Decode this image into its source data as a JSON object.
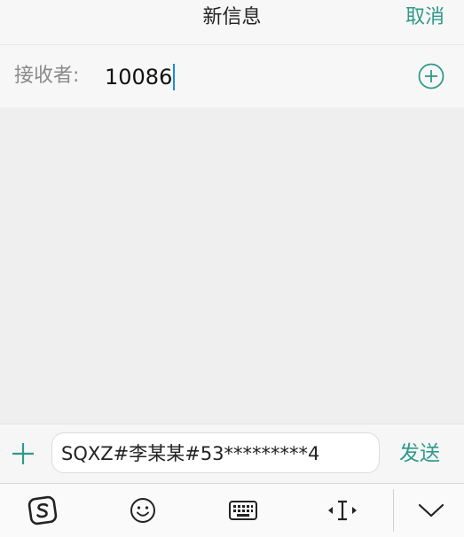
{
  "header": {
    "title": "新信息",
    "cancel_label": "取消"
  },
  "recipient": {
    "label": "接收者:",
    "value": "10086"
  },
  "compose": {
    "message": "SQXZ#李某某#53*********4",
    "send_label": "发送"
  },
  "toolbar": {
    "icons": [
      "sogou-input-icon",
      "emoji-icon",
      "keyboard-icon",
      "cursor-move-icon",
      "collapse-keyboard-icon"
    ]
  },
  "colors": {
    "accent": "#2f9a8b",
    "caret": "#1e88e5",
    "background": "#efefef"
  }
}
